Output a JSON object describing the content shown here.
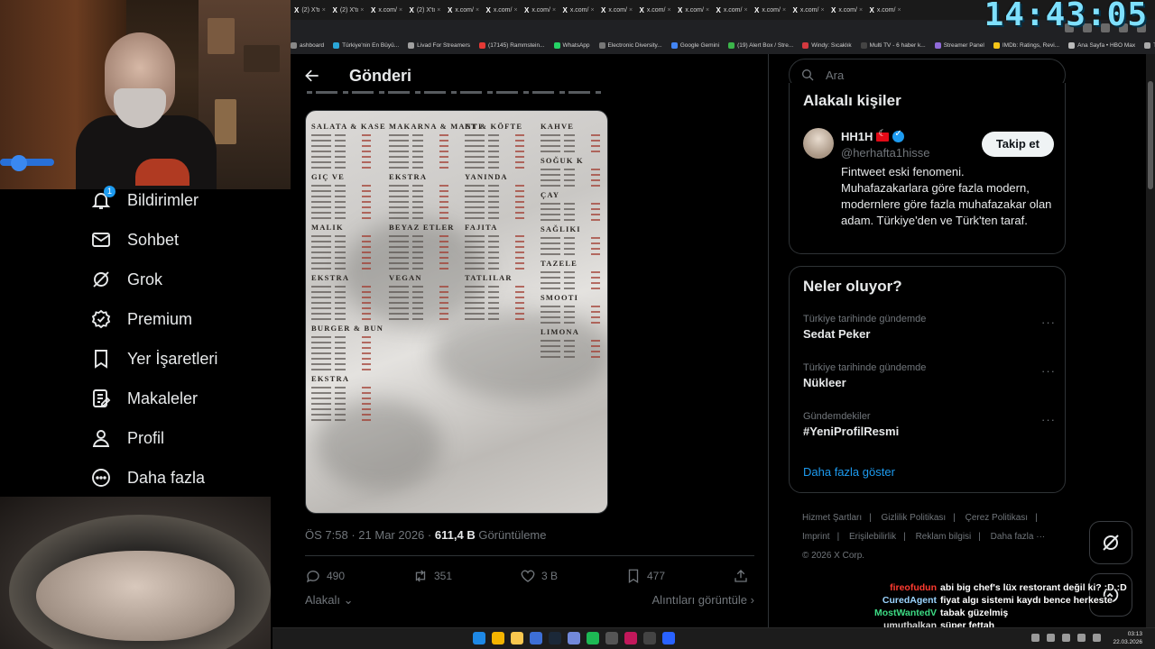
{
  "clock": "14:43:05",
  "tabs": [
    {
      "label": "(2) X'tı"
    },
    {
      "label": "(2) X'tı"
    },
    {
      "label": "x.com/"
    },
    {
      "label": "(2) X'tı"
    },
    {
      "label": "x.com/"
    },
    {
      "label": "x.com/"
    },
    {
      "label": "x.com/"
    },
    {
      "label": "x.com/"
    },
    {
      "label": "x.com/"
    },
    {
      "label": "x.com/"
    },
    {
      "label": "x.com/"
    },
    {
      "label": "x.com/"
    },
    {
      "label": "x.com/"
    },
    {
      "label": "x.com/"
    },
    {
      "label": "x.com/"
    },
    {
      "label": "x.com/"
    }
  ],
  "bookmarks": [
    {
      "label": "ashboard",
      "color": "#888888"
    },
    {
      "label": "Türkiye'nin En Büyü...",
      "color": "#2aa6d8"
    },
    {
      "label": "Livad For Streamers",
      "color": "#a0a0a0"
    },
    {
      "label": "(17145) Rammstein...",
      "color": "#e53935"
    },
    {
      "label": "WhatsApp",
      "color": "#25d366"
    },
    {
      "label": "Electronic Diversity...",
      "color": "#777777"
    },
    {
      "label": "Google Gemini",
      "color": "#4285f4"
    },
    {
      "label": "(19) Alert Box / Stre...",
      "color": "#3bb54a"
    },
    {
      "label": "Windy: Sıcaklık",
      "color": "#d4393f"
    },
    {
      "label": "Multi TV - 6 haber k...",
      "color": "#444444"
    },
    {
      "label": "Streamer Panel",
      "color": "#8f6ad8"
    },
    {
      "label": "IMDb: Ratings, Revi...",
      "color": "#f5c518"
    },
    {
      "label": "Ana Sayfa • HBO Max",
      "color": "#bbbbbb"
    },
    {
      "label": "Tüm Yer İşaretleri",
      "color": "#aaaaaa"
    }
  ],
  "nav": {
    "items": [
      {
        "label": "Bildirimler",
        "icon": "bell-icon",
        "badge": "1"
      },
      {
        "label": "Sohbet",
        "icon": "envelope-icon"
      },
      {
        "label": "Grok",
        "icon": "grok-icon"
      },
      {
        "label": "Premium",
        "icon": "premium-badge-icon"
      },
      {
        "label": "Yer İşaretleri",
        "icon": "bookmark-icon"
      },
      {
        "label": "Makaleler",
        "icon": "article-icon"
      },
      {
        "label": "Profil",
        "icon": "person-icon"
      },
      {
        "label": "Daha fazla",
        "icon": "more-circle-icon"
      }
    ]
  },
  "post": {
    "header_title": "Gönderi",
    "menu_headings": {
      "col1": [
        "SALATA & KASE",
        "GIÇ VE",
        "MALIK",
        "EKSTRA",
        "BURGER & BUN",
        "EKSTRA"
      ],
      "col2": [
        "MAKARNA & MANTI",
        "EKSTRA",
        "BEYAZ ETLER",
        "VEGAN"
      ],
      "col3": [
        "ET & KÖFTE",
        "YANINDA",
        "FAJITA",
        "TATLILAR"
      ],
      "col4": [
        "KAHVE",
        "SOĞUK K",
        "ÇAY",
        "SAĞLIKI",
        "TAZELE",
        "SMOOTI",
        "LIMONA"
      ]
    },
    "time": "ÖS 7:58",
    "date": "21 Mar 2026",
    "separator": "·",
    "views_value": "611,4 B",
    "views_label": "Görüntüleme",
    "actions": {
      "replies": "490",
      "reposts": "351",
      "likes": "3 B",
      "bookmarks": "477"
    },
    "relevant_label": "Alakalı",
    "quotes_label": "Alıntıları görüntüle"
  },
  "sidebar": {
    "search_placeholder": "Ara",
    "related_title": "Alakalı kişiler",
    "user": {
      "name": "HH1H",
      "handle": "@herhafta1hisse",
      "follow_label": "Takip et",
      "bio": "Fintweet eski fenomeni. Muhafazakarlara göre fazla modern, modernlere göre fazla muhafazakar olan adam. Türkiye'den ve Türk'ten taraf."
    },
    "trends_title": "Neler oluyor?",
    "trends": [
      {
        "context": "Türkiye tarihinde gündemde",
        "name": "Sedat Peker"
      },
      {
        "context": "Türkiye tarihinde gündemde",
        "name": "Nükleer"
      },
      {
        "context": "Gündemdekiler",
        "name": "#YeniProfilResmi"
      }
    ],
    "trend_more": "···",
    "show_more": "Daha fazla göster",
    "footer": {
      "links": [
        "Hizmet Şartları",
        "Gizlilik Politikası",
        "Çerez Politikası",
        "Imprint",
        "Erişilebilirlik",
        "Reklam bilgisi",
        "Daha fazla ···"
      ],
      "copyright": "© 2026 X Corp."
    }
  },
  "chat": [
    {
      "user": "fireofudun",
      "color": "#ff3b30",
      "text": "abi big chef's lüx restorant değil ki? :D :D"
    },
    {
      "user": "CuredAgent",
      "color": "#9bd4ff",
      "text": "fiyat algı sistemi kaydı bence herkeste"
    },
    {
      "user": "MostWantedV",
      "color": "#3ddc84",
      "text": "tabak güzelmiş"
    },
    {
      "user": "umutbalkan",
      "color": "#d8d8d8",
      "text": "süper fettah"
    }
  ],
  "taskbar": {
    "time": "03:13",
    "date": "22.03.2026"
  }
}
